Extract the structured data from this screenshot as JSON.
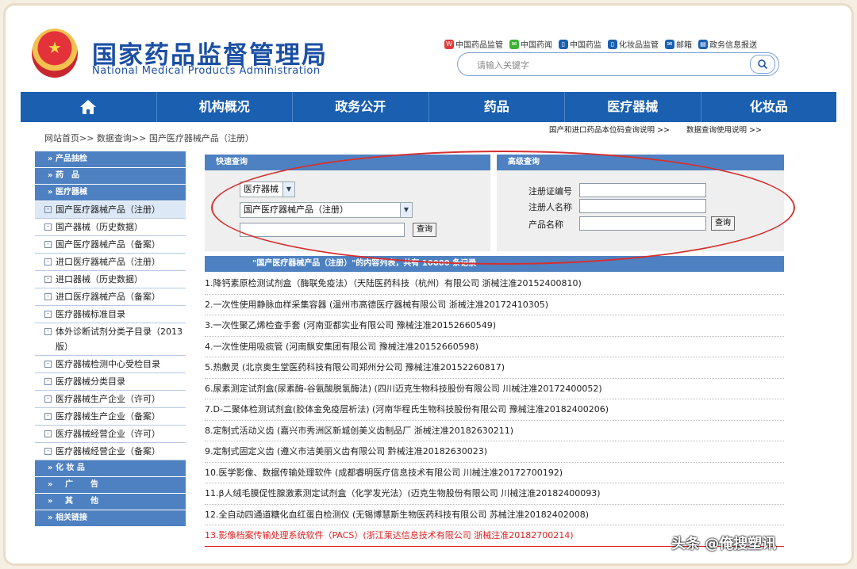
{
  "header": {
    "title_cn": "国家药品监督管理局",
    "title_en": "National Medical Products Administration"
  },
  "toplinks": [
    {
      "label": "中国药品监管",
      "icon": "weibo-icon",
      "color": "#e23a3a"
    },
    {
      "label": "中国药闻",
      "icon": "wechat-icon",
      "color": "#3cb034"
    },
    {
      "label": "中国药监",
      "icon": "mobile-icon",
      "color": "#1b5fb0"
    },
    {
      "label": "化妆品监管",
      "icon": "mobile-icon",
      "color": "#1b5fb0"
    },
    {
      "label": "邮箱",
      "icon": "mail-icon",
      "color": "#1b5fb0"
    },
    {
      "label": "政务信息报送",
      "icon": "report-icon",
      "color": "#1b5fb0"
    }
  ],
  "search": {
    "placeholder": "请输入关键字"
  },
  "nav": [
    "机构概况",
    "政务公开",
    "药品",
    "医疗器械",
    "化妆品"
  ],
  "breadcrumb": "网站首页>> 数据查询>> 国产医疗器械产品（注册）",
  "right_links": [
    "国产和进口药品本位码查询说明 >>",
    "数据查询使用说明 >>"
  ],
  "sidebar": {
    "h1": "产品抽检",
    "h2": "药　品",
    "h3": "医疗器械",
    "items": [
      "国产医疗器械产品（注册）",
      "国产器械（历史数据）",
      "国产医疗器械产品（备案）",
      "进口医疗器械产品（注册）",
      "进口器械（历史数据）",
      "进口医疗器械产品（备案）",
      "医疗器械标准目录",
      "体外诊断试剂分类子目录（2013版）",
      "医疗器械检测中心受检目录",
      "医疗器械分类目录",
      "医疗器械生产企业（许可）",
      "医疗器械生产企业（备案）",
      "医疗器械经营企业（许可）",
      "医疗器械经营企业（备案）"
    ],
    "h4": "化 妆 品",
    "h5": "广　告",
    "h6": "其　他",
    "h7": "相关链接"
  },
  "quick": {
    "title": "快速查询",
    "category": "医疗器械",
    "product": "国产医疗器械产品（注册）",
    "button": "查询"
  },
  "advanced": {
    "title": "高级查询",
    "f1": "注册证编号",
    "f2": "注册人名称",
    "f3": "产品名称",
    "button": "查询"
  },
  "results_title": "\"国产医疗器械产品（注册）\"的内容列表，共有 10000 条记录",
  "results": [
    "1.降钙素原检测试剂盒（酶联免疫法）（天陆医药科技（杭州）有限公司 浙械注准20152400810)",
    "2.一次性使用静脉血样采集容器 (温州市高德医疗器械有限公司 浙械注准20172410305)",
    "3.一次性聚乙烯检查手套 (河南亚都实业有限公司 豫械注准20152660549)",
    "4.一次性使用吸痰管 (河南飘安集团有限公司 豫械注准20152660598)",
    "5.热敷灵 (北京奥生堂医药科技有限公司郑州分公司 豫械注准20152260817)",
    "6.尿素测定试剂盒(尿素酶-谷氨酸脱氢酶法) (四川迈克生物科技股份有限公司 川械注准20172400052)",
    "7.D-二聚体检测试剂盒(胶体金免疫层析法) (河南华程氏生物科技股份有限公司 豫械注准20182400206)",
    "8.定制式活动义齿 (嘉兴市秀洲区新城创美义齿制品厂 浙械注准20182630211)",
    "9.定制式固定义齿 (遵义市洁美丽义齿有限公司 黔械注准20182630023)",
    "10.医学影像、数据传输处理软件 (成都睿明医疗信息技术有限公司 川械注准20172700192)",
    "11.β人绒毛膜促性腺激素测定试剂盒（化学发光法）(迈克生物股份有限公司 川械注准20182400093)",
    "12.全自动四通道糖化血红蛋白检测仪 (无锡博慧斯生物医药科技有限公司 苏械注准20182402008)",
    "13.影像档案传输处理系统软件（PACS）(浙江莱达信息技术有限公司 浙械注准20182700214)"
  ],
  "watermark": "头条 @俺搜塑讯"
}
